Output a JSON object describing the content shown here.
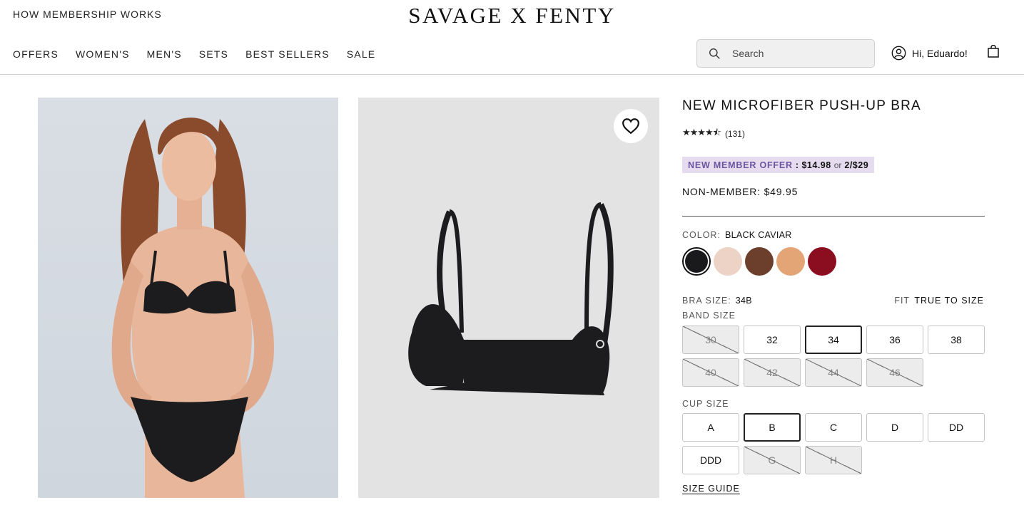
{
  "header": {
    "how_membership": "HOW MEMBERSHIP WORKS",
    "logo": "SAVAGE X FENTY",
    "nav": [
      "OFFERS",
      "WOMEN'S",
      "MEN'S",
      "SETS",
      "BEST SELLERS",
      "SALE"
    ],
    "search_placeholder": "Search",
    "greeting": "Hi, Eduardo!"
  },
  "product": {
    "title": "NEW MICROFIBER PUSH-UP BRA",
    "rating_stars": 4.5,
    "rating_count": "(131)",
    "offer_label": "NEW MEMBER OFFER",
    "offer_price": ": $14.98",
    "offer_or": "or",
    "offer_bundle": "2/$29",
    "non_member": "NON-MEMBER: $49.95",
    "color_label": "COLOR:",
    "color_value": "BLACK CAVIAR",
    "swatches": [
      "#1a1a1c",
      "#ecd3c6",
      "#6b3f2c",
      "#e3a575",
      "#8a0d20"
    ],
    "bra_size_label": "BRA SIZE:",
    "bra_size_value": "34B",
    "fit_label": "FIT",
    "fit_value": "TRUE TO SIZE",
    "band_size_label": "BAND SIZE",
    "band_sizes": [
      {
        "label": "30",
        "state": "na"
      },
      {
        "label": "32",
        "state": "ok"
      },
      {
        "label": "34",
        "state": "sel"
      },
      {
        "label": "36",
        "state": "ok"
      },
      {
        "label": "38",
        "state": "ok"
      },
      {
        "label": "40",
        "state": "na"
      },
      {
        "label": "42",
        "state": "na"
      },
      {
        "label": "44",
        "state": "na"
      },
      {
        "label": "46",
        "state": "na"
      }
    ],
    "cup_size_label": "CUP SIZE",
    "cup_sizes": [
      {
        "label": "A",
        "state": "ok"
      },
      {
        "label": "B",
        "state": "sel"
      },
      {
        "label": "C",
        "state": "ok"
      },
      {
        "label": "D",
        "state": "ok"
      },
      {
        "label": "DD",
        "state": "ok"
      },
      {
        "label": "DDD",
        "state": "ok"
      },
      {
        "label": "G",
        "state": "na"
      },
      {
        "label": "H",
        "state": "na"
      }
    ],
    "size_guide": "SIZE GUIDE"
  }
}
